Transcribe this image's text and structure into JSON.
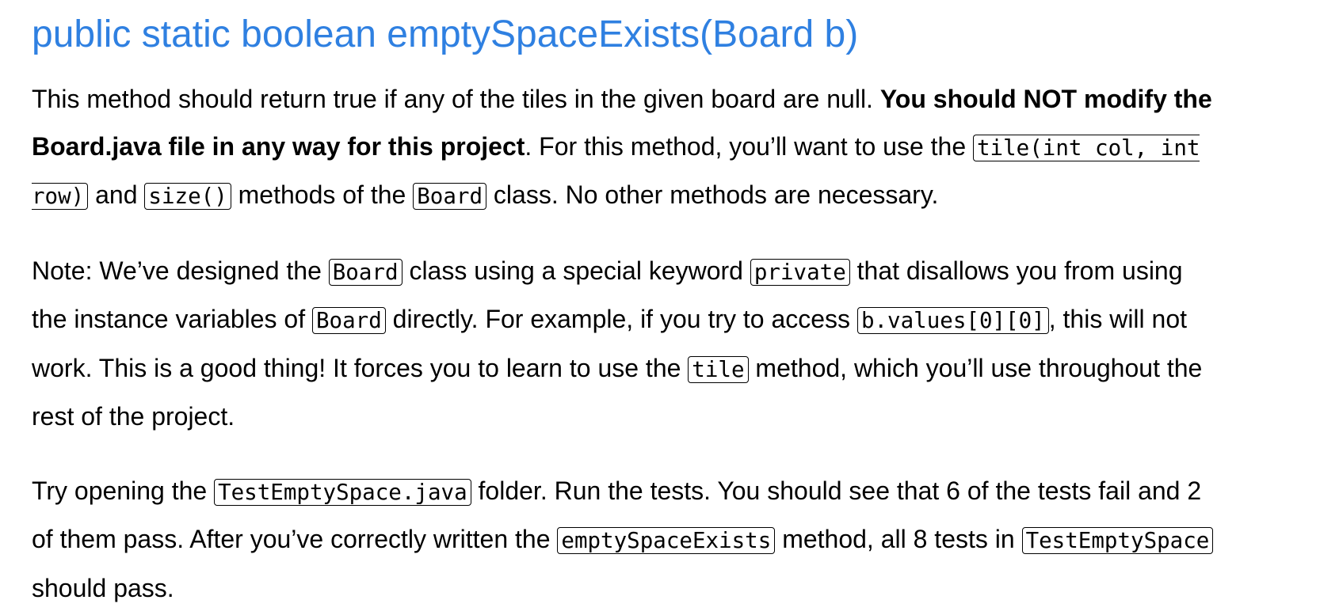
{
  "heading": "public static boolean emptySpaceExists(Board b)",
  "para1": {
    "t1": "This method should return true if any of the tiles in the given board are null. ",
    "b1": "You should NOT modify the",
    "b2": "Board.java file in any way for this project",
    "t2": ". For this method, you’ll want to use the ",
    "c1a": "tile(int col, int",
    "c1b": "row)",
    "t3": " and ",
    "c2": "size()",
    "t4": " methods of the ",
    "c3": "Board",
    "t5": " class. No other methods are necessary."
  },
  "para2": {
    "t1": "Note: We’ve designed the ",
    "c1": "Board",
    "t2": " class using a special keyword ",
    "c2": "private",
    "t3": " that disallows you from using",
    "t4": "the instance variables of ",
    "c3": "Board",
    "t5": " directly. For example, if you try to access ",
    "c4": "b.values[0][0]",
    "t6": ", this will not",
    "t7": "work. This is a good thing! It forces you to learn to use the ",
    "c5": "tile",
    "t8": " method, which you’ll use throughout the",
    "t9": "rest of the project."
  },
  "para3": {
    "t1": "Try opening the ",
    "c1": "TestEmptySpace.java",
    "t2": " folder. Run the tests. You should see that 6 of the tests fail and 2",
    "t3": "of them pass. After you’ve correctly written the ",
    "c2": "emptySpaceExists",
    "t4": " method, all 8 tests in ",
    "c3": "TestEmptySpace",
    "t5": "should pass."
  }
}
